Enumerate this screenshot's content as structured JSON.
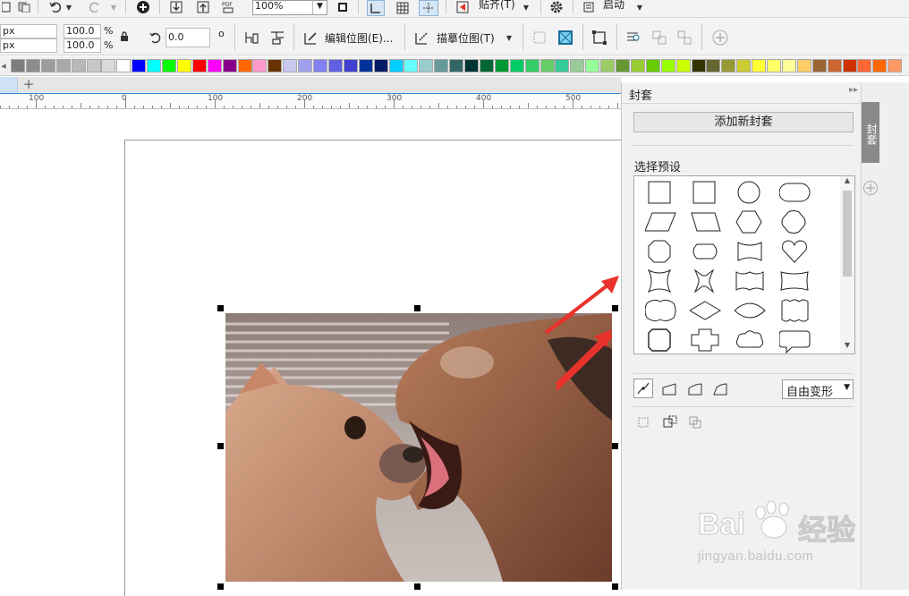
{
  "toolbar1": {
    "zoom": "100%",
    "paste_label": "贴齐(T)",
    "launch_label": "启动"
  },
  "toolbar2": {
    "unit1": "px",
    "unit2": "px",
    "scale_x": "100.0",
    "scale_y": "100.0",
    "pct1": "%",
    "pct2": "%",
    "rotation": "0.0",
    "degree": "o",
    "edit_bitmap_label": "编辑位图(E)...",
    "trace_bitmap_label": "描摹位图(T)"
  },
  "ruler": {
    "labels": [
      "100",
      "100",
      "200",
      "300",
      "400",
      "500"
    ]
  },
  "palette": {
    "colors": [
      "#7d7d7d",
      "#8c8c8c",
      "#9b9b9b",
      "#a9a9a9",
      "#b8b8b8",
      "#c8c8c8",
      "#dadada",
      "#ffffff",
      "#0000ff",
      "#00ffff",
      "#00ff00",
      "#ffff00",
      "#ff0000",
      "#ff00ff",
      "#8b008b",
      "#ff6600",
      "#ff99cc",
      "#663300",
      "#c8c8f0",
      "#a0a0f0",
      "#8080f0",
      "#6060e0",
      "#4040d0",
      "#003399",
      "#001a66",
      "#00ccff",
      "#66ffff",
      "#99cccc",
      "#669999",
      "#336666",
      "#003333",
      "#006633",
      "#009933",
      "#00cc66",
      "#33cc66",
      "#66cc66",
      "#33cc99",
      "#99cc99",
      "#99ff99",
      "#99cc66",
      "#669933",
      "#99cc33",
      "#66cc00",
      "#99ff00",
      "#ccff00",
      "#333300",
      "#666633",
      "#999933",
      "#cccc33",
      "#ffff33",
      "#ffff66",
      "#ffff99",
      "#ffcc66",
      "#996633",
      "#cc6633",
      "#cc3300",
      "#ff6633",
      "#ff6600",
      "#ff9966"
    ]
  },
  "docker": {
    "title": "封套",
    "add_new_button": "添加新封套",
    "preset_section_label": "选择预设",
    "mode_select": "自由变形",
    "side_tab_label": "封套"
  },
  "watermark": {
    "brand": "Bai",
    "brand2": "经验",
    "url": "jingyan.baidu.com"
  },
  "colors": {
    "accent": "#3b8de0",
    "arrow": "#e8322b"
  }
}
